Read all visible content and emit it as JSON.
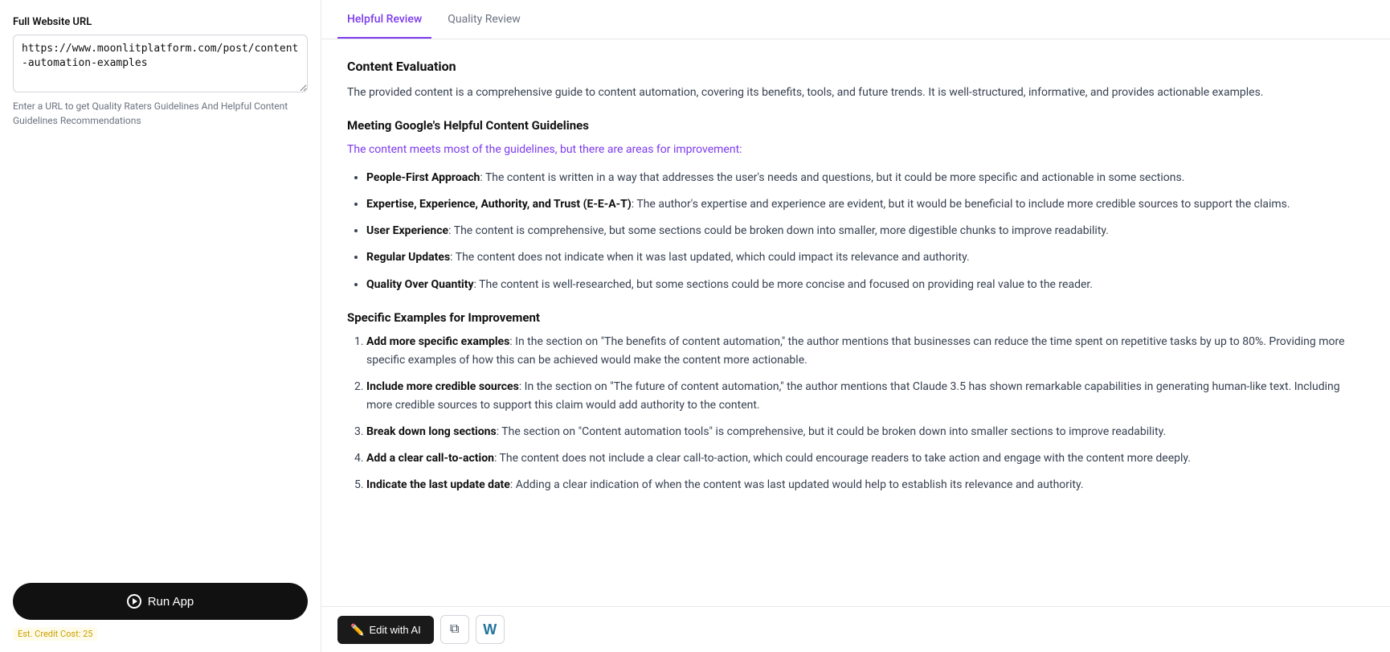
{
  "left": {
    "label": "Full Website URL",
    "url_value": "https://www.moonlitplatform.com/post/content-automation-examples",
    "url_placeholder": "https://www.moonlitplatform.com/post/content-automation-examples",
    "hint": "Enter a URL to get Quality Raters Guidelines And Helpful Content Guidelines Recommendations",
    "run_button_label": "Run App",
    "credit_cost": "Est. Credit Cost: 25"
  },
  "tabs": [
    {
      "id": "helpful-review",
      "label": "Helpful Review",
      "active": true
    },
    {
      "id": "quality-review",
      "label": "Quality Review",
      "active": false
    }
  ],
  "content": {
    "section_title": "Content Evaluation",
    "intro": "The provided content is a comprehensive guide to content automation, covering its benefits, tools, and future trends. It is well-structured, informative, and provides actionable examples.",
    "helpful_guidelines_title": "Meeting Google's Helpful Content Guidelines",
    "meets_text": "The content meets most of the guidelines, but there are areas for improvement:",
    "bullet_points": [
      {
        "bold": "People-First Approach",
        "text": ": The content is written in a way that addresses the user's needs and questions, but it could be more specific and actionable in some sections."
      },
      {
        "bold": "Expertise, Experience, Authority, and Trust (E-E-A-T)",
        "text": ": The author's expertise and experience are evident, but it would be beneficial to include more credible sources to support the claims."
      },
      {
        "bold": "User Experience",
        "text": ": The content is comprehensive, but some sections could be broken down into smaller, more digestible chunks to improve readability."
      },
      {
        "bold": "Regular Updates",
        "text": ": The content does not indicate when it was last updated, which could impact its relevance and authority."
      },
      {
        "bold": "Quality Over Quantity",
        "text": ": The content is well-researched, but some sections could be more concise and focused on providing real value to the reader."
      }
    ],
    "specific_examples_title": "Specific Examples for Improvement",
    "numbered_items": [
      {
        "bold": "Add more specific examples",
        "text": ": In the section on \"The benefits of content automation,\" the author mentions that businesses can reduce the time spent on repetitive tasks by up to 80%. Providing more specific examples of how this can be achieved would make the content more actionable."
      },
      {
        "bold": "Include more credible sources",
        "text": ": In the section on \"The future of content automation,\" the author mentions that Claude 3.5 has shown remarkable capabilities in generating human-like text. Including more credible sources to support this claim would add authority to the content."
      },
      {
        "bold": "Break down long sections",
        "text": ": The section on \"Content automation tools\" is comprehensive, but it could be broken down into smaller sections to improve readability."
      },
      {
        "bold": "Add a clear call-to-action",
        "text": ": The content does not include a clear call-to-action, which could encourage readers to take action and engage with the content more deeply."
      },
      {
        "bold": "Indicate the last update date",
        "text": ": Adding a clear indication of when the content was last updated would help to establish its relevance and authority."
      }
    ]
  },
  "bottom_bar": {
    "edit_ai_label": "Edit with AI",
    "copy_icon": "copy",
    "wordpress_icon": "wordpress"
  }
}
